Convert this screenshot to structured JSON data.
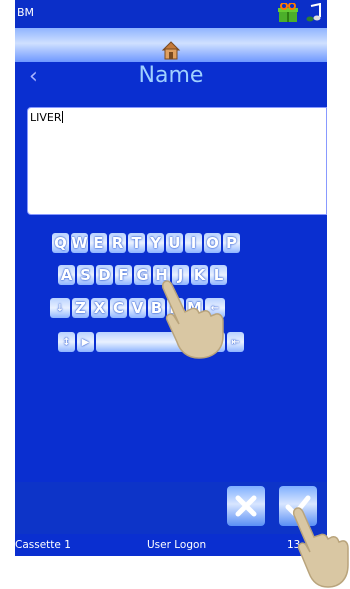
{
  "statusbar": {
    "title": "BM",
    "icons": [
      "gift-icon",
      "music-note-icon"
    ]
  },
  "home": {
    "icon": "home-icon"
  },
  "header": {
    "back_icon": "chevron-left-icon",
    "back_glyph": "‹",
    "title": "Name"
  },
  "text_field": {
    "value": "LIVER"
  },
  "keyboard": {
    "row1": [
      "Q",
      "W",
      "E",
      "R",
      "T",
      "Y",
      "U",
      "I",
      "O",
      "P"
    ],
    "row2": [
      "A",
      "S",
      "D",
      "F",
      "G",
      "H",
      "J",
      "K",
      "L"
    ],
    "row3": [
      "↓",
      "Z",
      "X",
      "C",
      "V",
      "B",
      "N",
      "M",
      "←"
    ],
    "row4": [
      "↕",
      "▶",
      "",
      "↓",
      "⇤"
    ]
  },
  "footer": {
    "cancel_icon": "x-icon",
    "confirm_icon": "check-icon"
  },
  "bottombar": {
    "cassette": "Cassette 1",
    "user": "User Logon",
    "time": "13:40"
  },
  "colors": {
    "screen_bg": "#0a2fd0",
    "title": "#9fd0ff",
    "accent": "#8fb4ff"
  }
}
